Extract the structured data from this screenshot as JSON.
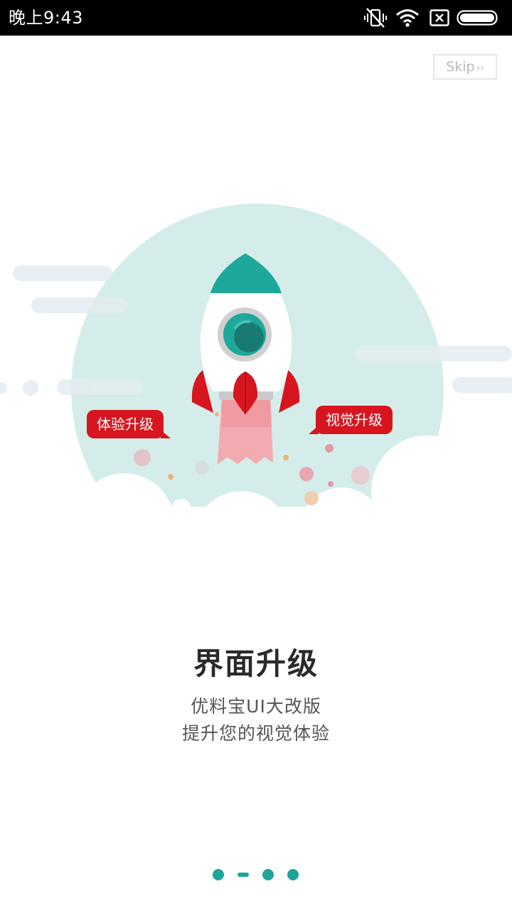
{
  "status_bar": {
    "time": "晚上9:43",
    "icons": [
      "vibrate-off-icon",
      "wifi-icon",
      "sim-error-icon",
      "battery-icon"
    ]
  },
  "skip": {
    "label": "Skip",
    "chevron": "››"
  },
  "illustration": {
    "bubbles": {
      "left": "体验升级",
      "right": "视觉升级"
    },
    "colors": {
      "circle": "#d4edea",
      "rocket_top": "#1ea89c",
      "rocket_fin": "#d7151f",
      "exhaust": "#f3aab0",
      "cloud": "#e8eef2"
    }
  },
  "content": {
    "title": "界面升级",
    "subtitle_line1": "优料宝UI大改版",
    "subtitle_line2": "提升您的视觉体验"
  },
  "pager": {
    "page_count": 4,
    "current_page": 2,
    "accent": "#20a39b"
  }
}
